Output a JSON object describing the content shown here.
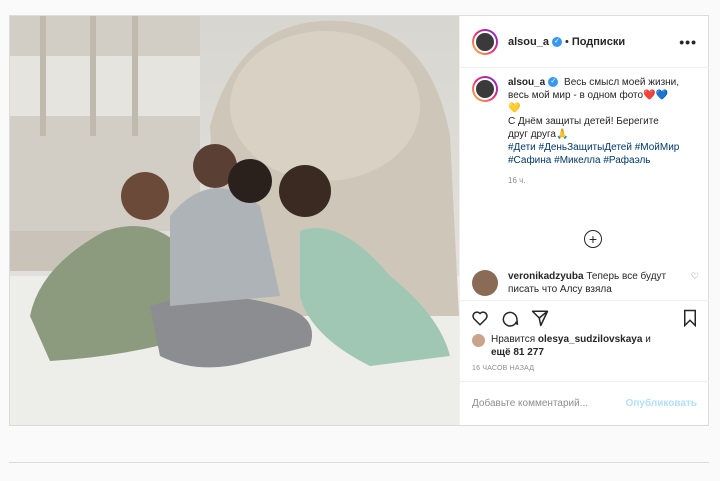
{
  "post": {
    "username": "alsou_a",
    "follow_sep": "•",
    "follow_label": "Подписки",
    "more": "•••",
    "caption_line1": "Весь смысл моей жизни, весь мой мир - в одном фото",
    "caption_emoji": "❤️💙💛",
    "caption_line2": "С Днём защиты детей! Берегите друг друга🙏",
    "hashtags": "#Дети #ДеньЗащитыДетей #МойМир #Сафина #Микелла #Рафаэль",
    "time_short": "16 ч.",
    "add_comments_icon": "plus-circle-icon"
  },
  "comment": {
    "username": "veronikadzyuba",
    "text": "Теперь все будут писать что Алсу взяла"
  },
  "likes": {
    "prefix": "Нравится",
    "user": "olesya_sudzilovskaya",
    "connector": "и",
    "others": "ещё 81 277"
  },
  "time_full": "16 ЧАСОВ НАЗАД",
  "add_comment": {
    "placeholder": "Добавьте комментарий...",
    "publish": "Опубликовать"
  },
  "colors": {
    "accent": "#3897f0",
    "tag": "#00376b",
    "publish_disabled": "#b2dffc"
  }
}
